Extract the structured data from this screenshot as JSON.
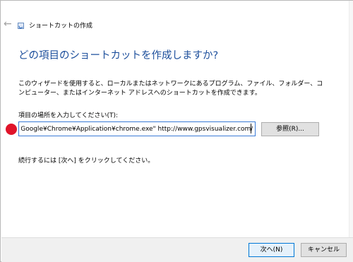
{
  "window": {
    "title": "ショートカットの作成",
    "back_icon": "arrow-left-icon",
    "app_icon": "shortcut-icon"
  },
  "main": {
    "heading": "どの項目のショートカットを作成しますか?",
    "description": "このウィザードを使用すると、ローカルまたはネットワークにあるプログラム、ファイル、フォルダー、コンピューター、またはインターネット アドレスへのショートカットを作成できます。",
    "field_label": "項目の場所を入力してください(T):",
    "location_value": ")¥Google¥Chrome¥Application¥chrome.exe\" http://www.gpsvisualizer.com/",
    "browse_label": "参照(R)...",
    "instruction": "続行するには [次へ] をクリックしてください。"
  },
  "footer": {
    "next_label": "次へ(N)",
    "cancel_label": "キャンセル"
  },
  "colors": {
    "heading": "#1d4f9c",
    "marker": "#e0142a",
    "focus_border": "#3a7bd6"
  }
}
